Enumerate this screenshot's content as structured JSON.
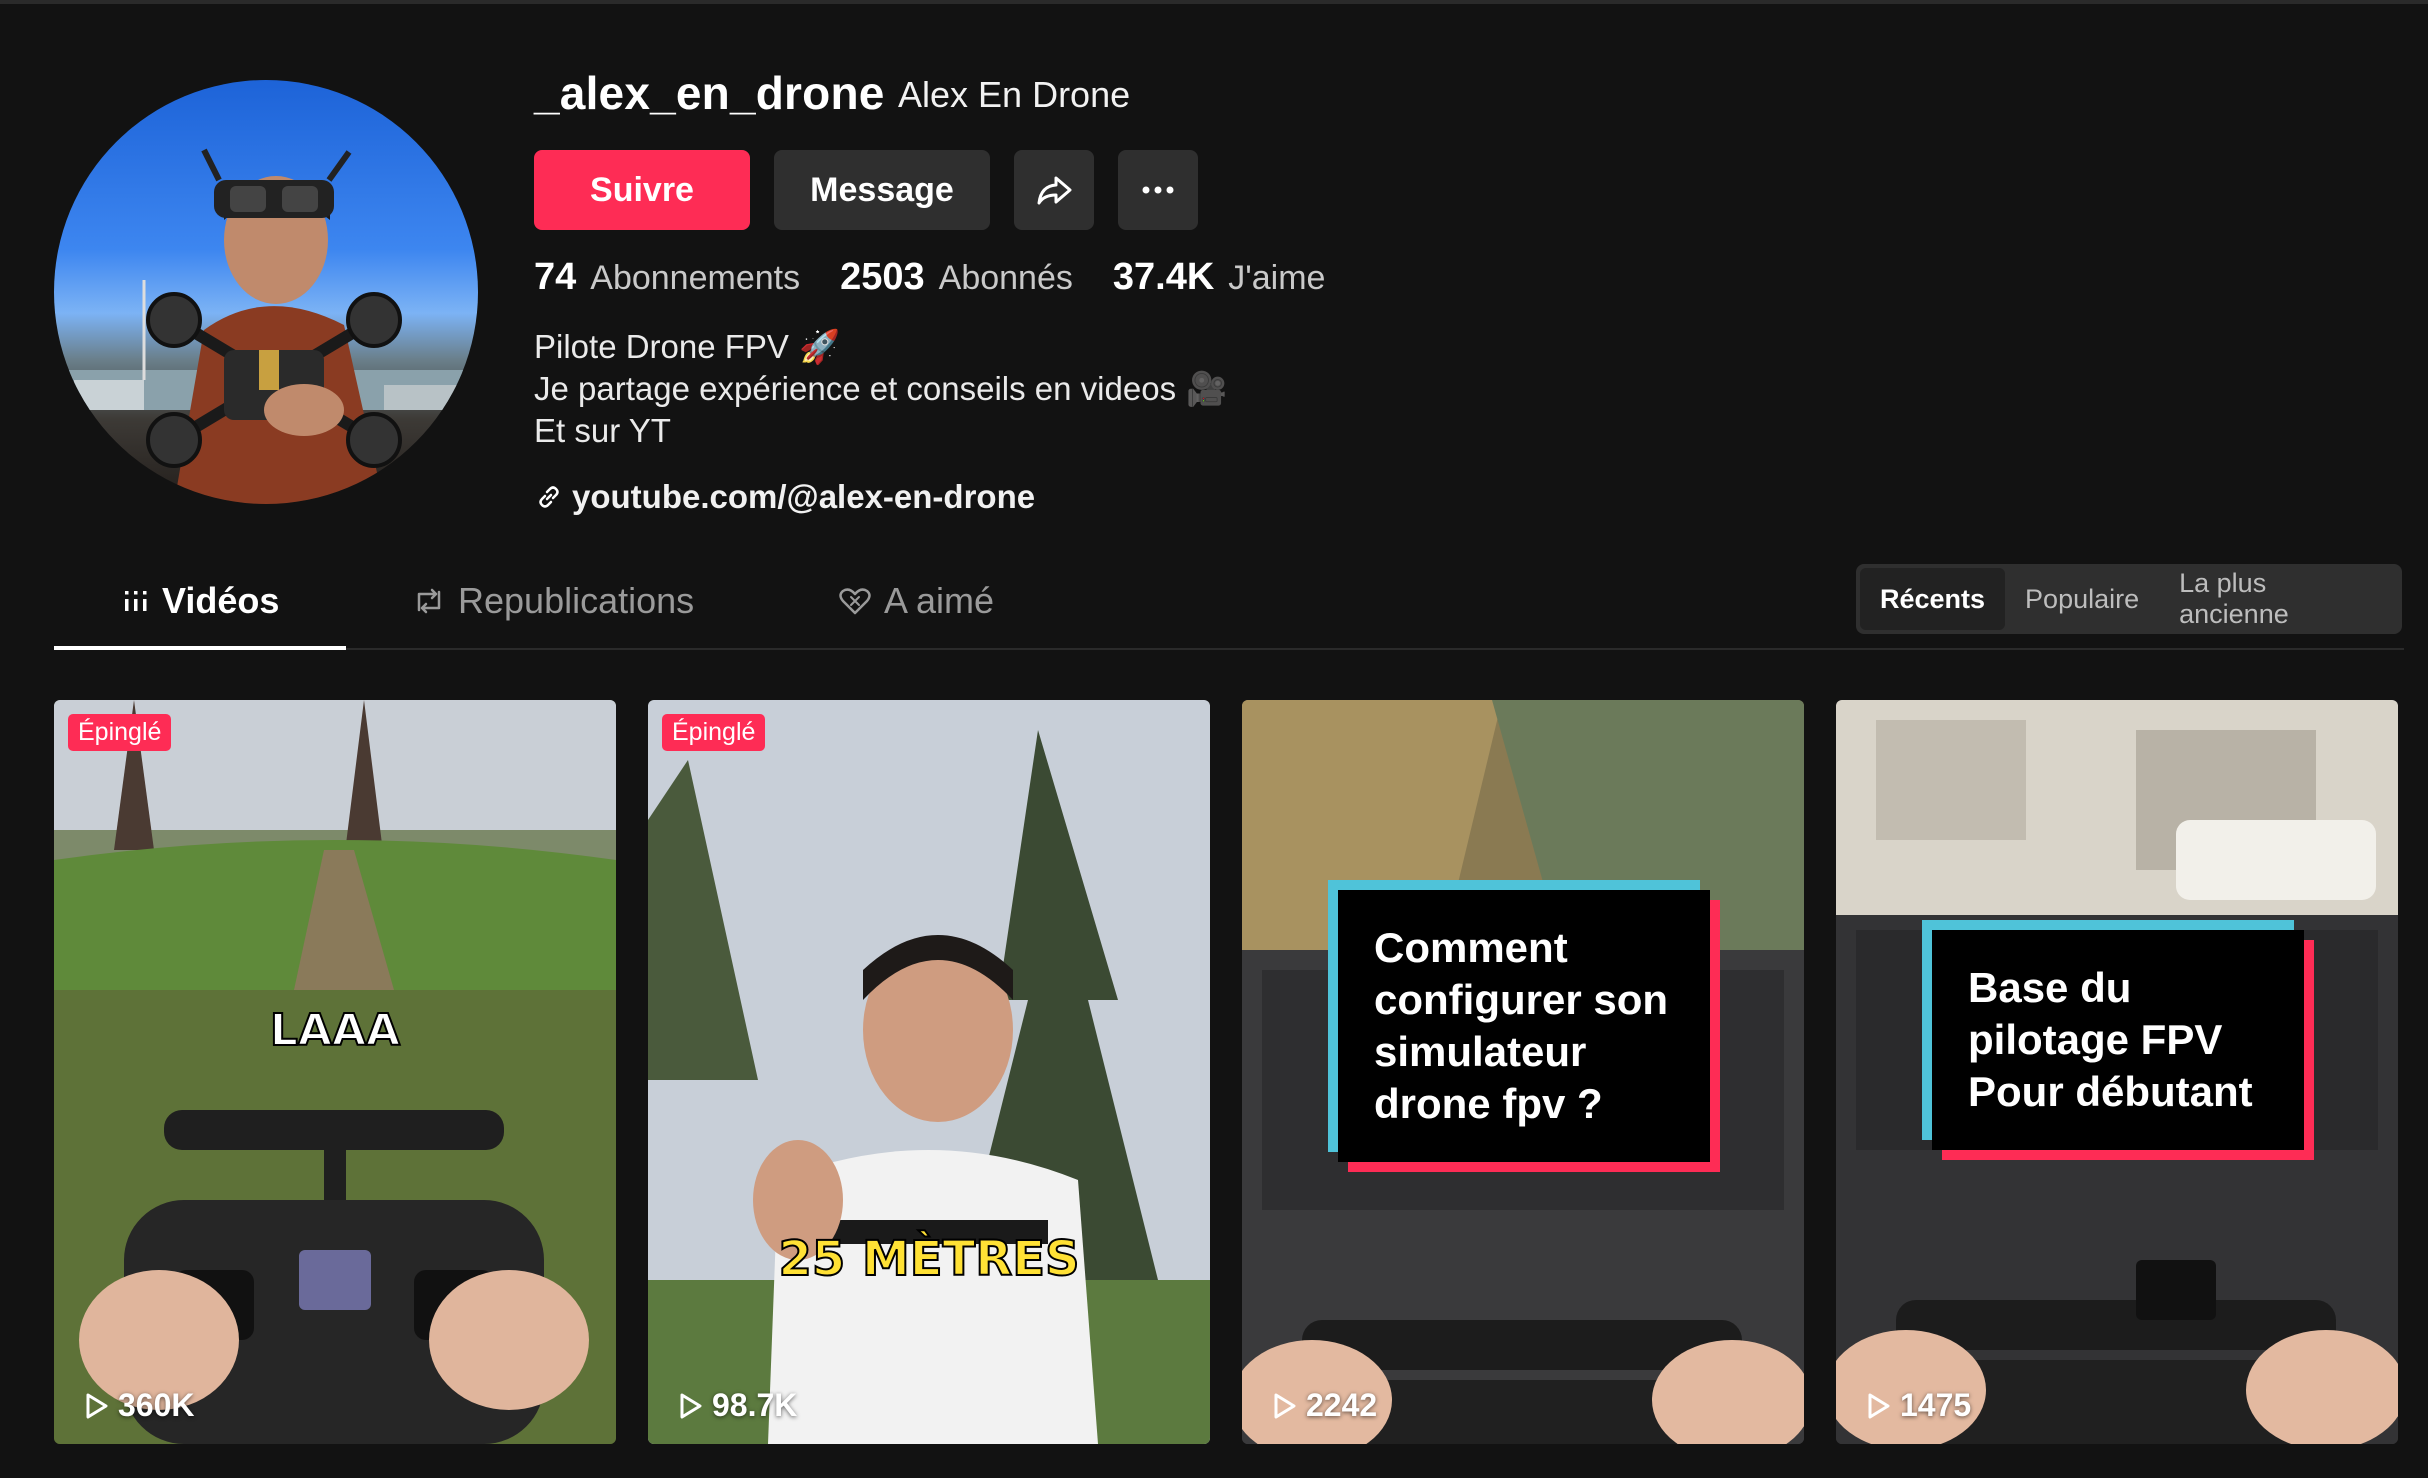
{
  "profile": {
    "username": "_alex_en_drone",
    "display_name": "Alex En Drone",
    "follow_label": "Suivre",
    "message_label": "Message",
    "share_icon": "share-icon",
    "more_icon": "more-icon"
  },
  "stats": [
    {
      "value": "74",
      "label": "Abonnements"
    },
    {
      "value": "2503",
      "label": "Abonnés"
    },
    {
      "value": "37.4K",
      "label": "J'aime"
    }
  ],
  "bio": {
    "line1": "Pilote Drone FPV",
    "line1_emoji": "🚀",
    "line2": "Je partage expérience et conseils en videos",
    "line2_emoji": "🎥",
    "line3": "Et sur YT"
  },
  "link": "youtube.com/@alex-en-drone",
  "tabs": [
    {
      "label": "Vidéos",
      "icon": "grid-icon",
      "active": true
    },
    {
      "label": "Republications",
      "icon": "repost-icon",
      "active": false
    },
    {
      "label": "A aimé",
      "icon": "heart-icon",
      "active": false
    }
  ],
  "sort": [
    {
      "label": "Récents",
      "active": true
    },
    {
      "label": "Populaire",
      "active": false
    },
    {
      "label": "La plus ancienne",
      "active": false
    }
  ],
  "videos": [
    {
      "pinned_label": "Épinglé",
      "views": "360K",
      "overlay": "LAAA"
    },
    {
      "pinned_label": "Épinglé",
      "views": "98.7K",
      "overlay": "25 MÈTRES"
    },
    {
      "pinned_label": "",
      "views": "2242",
      "overlay": "Comment configurer son simulateur drone fpv ?"
    },
    {
      "pinned_label": "",
      "views": "1475",
      "overlay": "Base du pilotage FPV Pour débutant"
    }
  ],
  "colors": {
    "background": "#121212",
    "accent": "#fe2c55",
    "button_dark": "#2f2f2f",
    "cyan_frame": "#4fc3d9"
  }
}
